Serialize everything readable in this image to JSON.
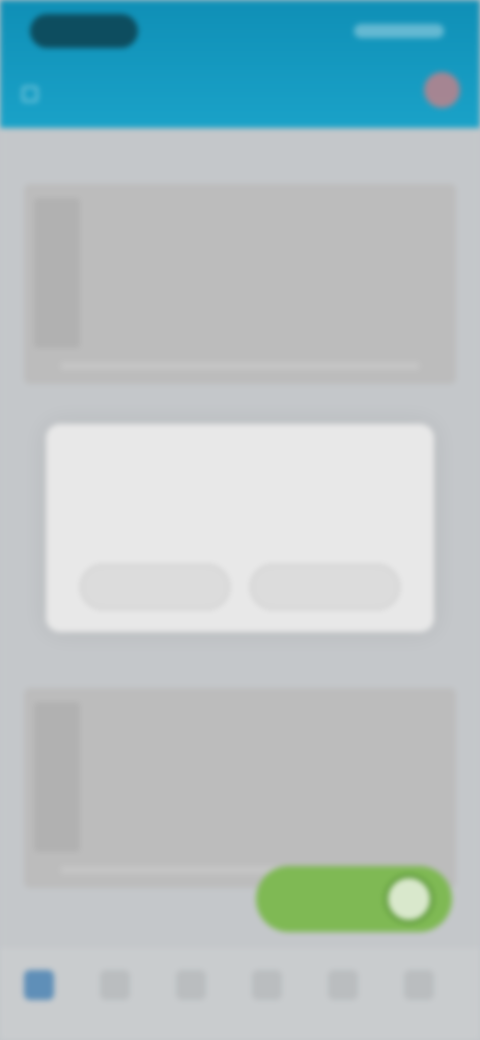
{
  "header": {
    "title": ""
  },
  "modal": {
    "title": "",
    "body": "",
    "left_button": "",
    "right_button": ""
  },
  "colors": {
    "header": "#1aa2c8",
    "fab": "#7fb954",
    "active_nav": "#5f8fb8",
    "avatar": "#c97f86"
  },
  "icons": {
    "nav_left": "back-icon",
    "avatar": "avatar-icon",
    "fab": "toggle-icon",
    "bottom_nav": [
      "home-icon",
      "list-icon",
      "calendar-icon",
      "chart-icon",
      "settings-icon",
      "more-icon"
    ]
  }
}
